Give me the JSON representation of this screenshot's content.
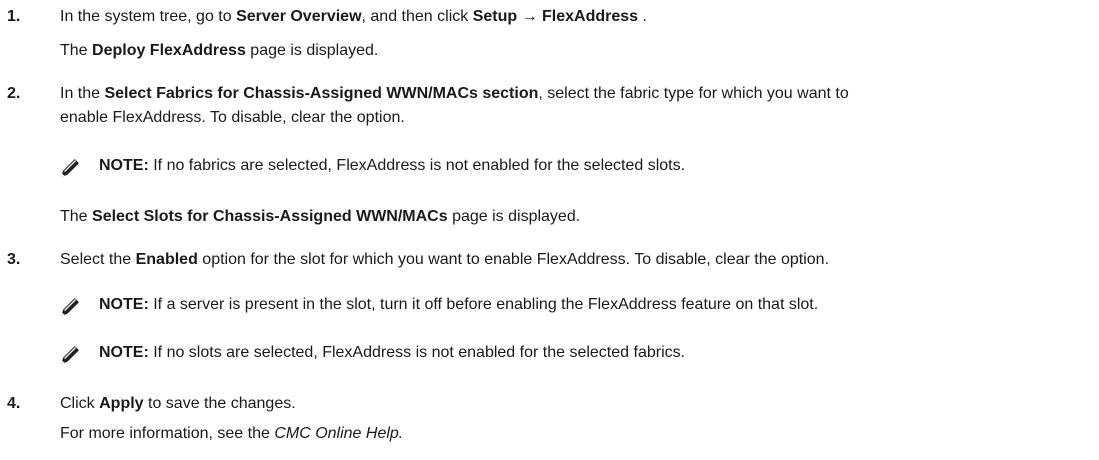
{
  "steps": [
    {
      "number": "1.",
      "line1": {
        "t1": "In the system tree, go to ",
        "b1": "Server Overview",
        "t2": ", and then click ",
        "b2": "Setup",
        "arrow": " → ",
        "b3": "FlexAddress",
        "t3": " ."
      },
      "line2": {
        "t1": "The ",
        "b1": "Deploy FlexAddress",
        "t2": " page is displayed."
      }
    },
    {
      "number": "2.",
      "line1": {
        "t1": "In the ",
        "b1": "Select Fabrics for Chassis-Assigned WWN/MACs section",
        "t2": ", select the fabric type for which you want to"
      },
      "line2": "enable FlexAddress. To disable, clear the option.",
      "note": {
        "label": "NOTE:",
        "text": " If no fabrics are selected, FlexAddress is not enabled for the selected slots."
      },
      "line3": {
        "t1": "The ",
        "b1": "Select Slots for Chassis-Assigned WWN/MACs",
        "t2": " page is displayed."
      }
    },
    {
      "number": "3.",
      "line1": {
        "t1": "Select the ",
        "b1": "Enabled",
        "t2": " option for the slot for which you want to enable FlexAddress. To disable, clear the option."
      },
      "notes": [
        {
          "label": "NOTE:",
          "text": " If a server is present in the slot, turn it off before enabling the FlexAddress feature on that slot."
        },
        {
          "label": "NOTE:",
          "text": " If no slots are selected, FlexAddress is not enabled for the selected fabrics."
        }
      ]
    },
    {
      "number": "4.",
      "line1": {
        "t1": "Click ",
        "b1": "Apply",
        "t2": " to save the changes."
      },
      "line2": {
        "t1": "For more information, see the ",
        "i1": "CMC Online Help.",
        "t2": ""
      }
    }
  ],
  "icon": {
    "name": "note-pencil-icon",
    "fill": "#222222"
  }
}
